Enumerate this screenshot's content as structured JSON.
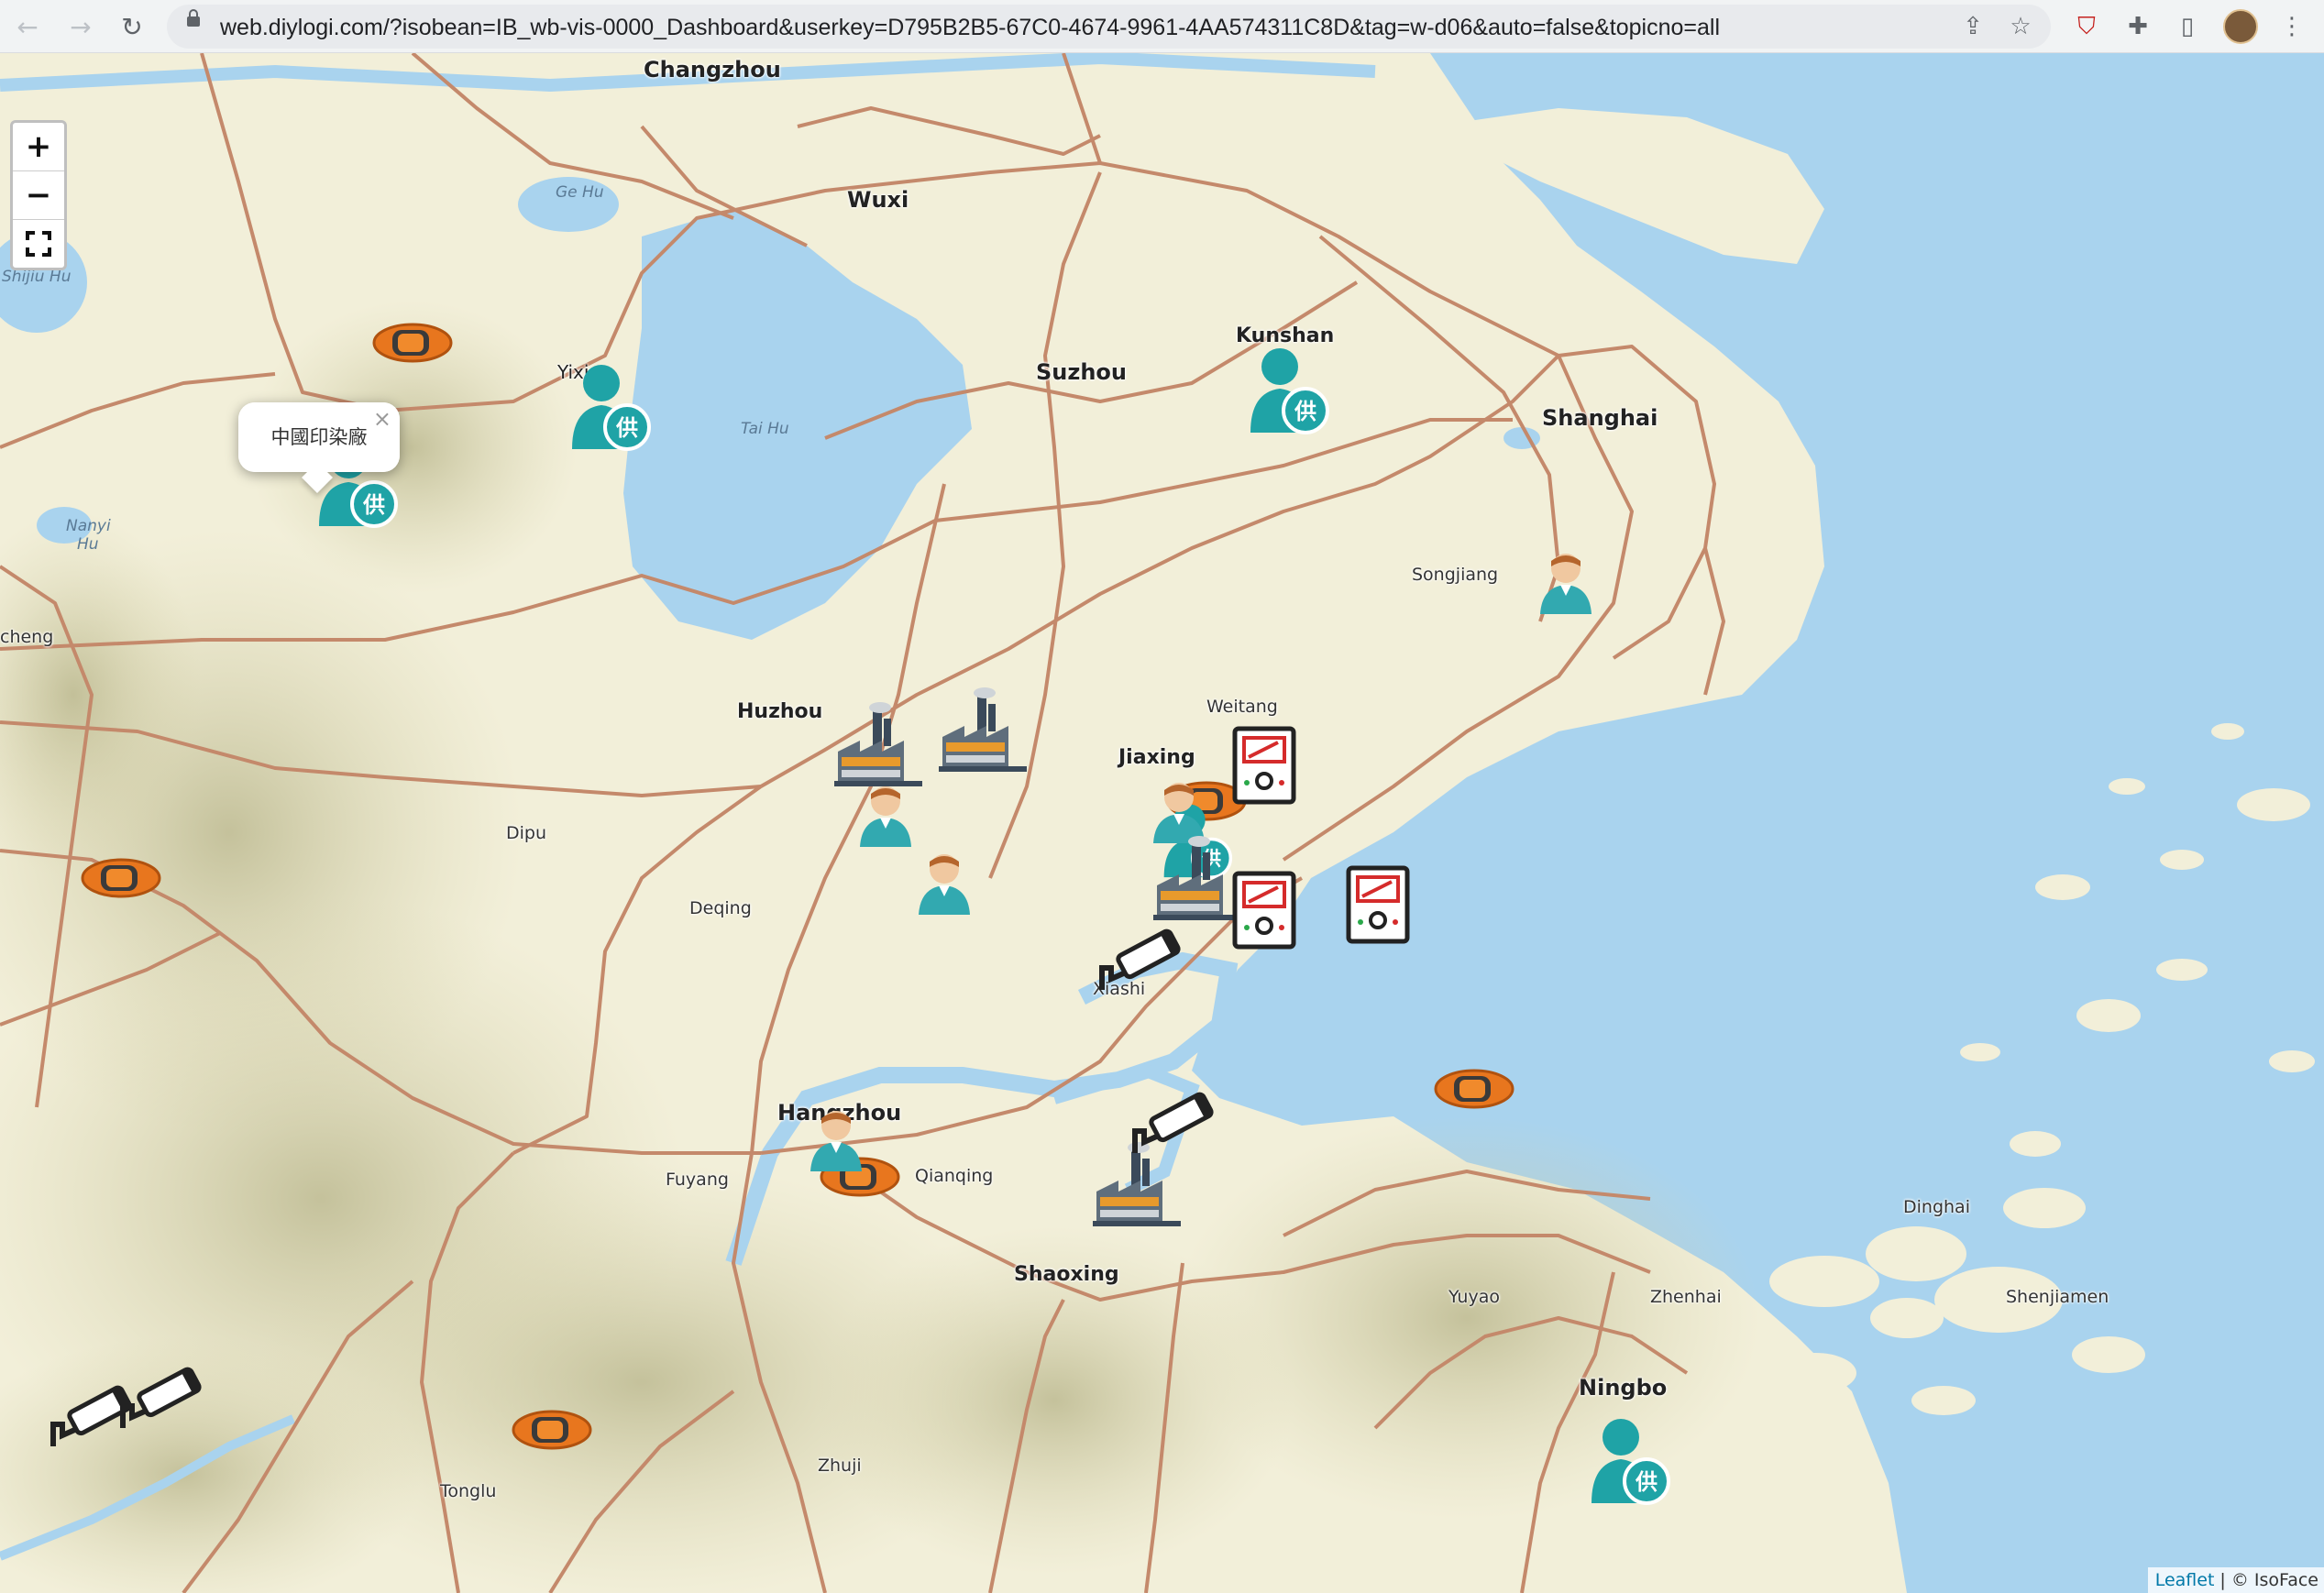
{
  "browser": {
    "url": "web.diylogi.com/?isobean=IB_wb-vis-0000_Dashboard&userkey=D795B2B5-67C0-4674-9961-4AA574311C8D&tag=w-d06&auto=false&topicno=all",
    "back_icon": "back-arrow-icon",
    "forward_icon": "forward-arrow-icon",
    "reload_icon": "reload-icon"
  },
  "map": {
    "zoom_in": "+",
    "zoom_out": "−",
    "fullscreen_icon": "fullscreen-icon",
    "popup_text": "中國印染廠",
    "popup_close": "×",
    "attribution_link": "Leaflet",
    "attribution_text": "| © IsoFace",
    "labels": [
      {
        "id": "changzhou",
        "text": "Changzhou",
        "kind": "city"
      },
      {
        "id": "wuxi",
        "text": "Wuxi",
        "kind": "city"
      },
      {
        "id": "suzhou",
        "text": "Suzhou",
        "kind": "city"
      },
      {
        "id": "kunshan",
        "text": "Kunshan",
        "kind": "city"
      },
      {
        "id": "shanghai",
        "text": "Shanghai",
        "kind": "city"
      },
      {
        "id": "yixing",
        "text": "Yixing",
        "kind": "city"
      },
      {
        "id": "huzhou",
        "text": "Huzhou",
        "kind": "city"
      },
      {
        "id": "jiaxing",
        "text": "Jiaxing",
        "kind": "city"
      },
      {
        "id": "hangzhou",
        "text": "Hangzhou",
        "kind": "city"
      },
      {
        "id": "shaoxing",
        "text": "Shaoxing",
        "kind": "city"
      },
      {
        "id": "ningbo",
        "text": "Ningbo",
        "kind": "city"
      },
      {
        "id": "songjiang",
        "text": "Songjiang",
        "kind": "town"
      },
      {
        "id": "weitang",
        "text": "Weitang",
        "kind": "town"
      },
      {
        "id": "dipu",
        "text": "Dipu",
        "kind": "town"
      },
      {
        "id": "deqing",
        "text": "Deqing",
        "kind": "town"
      },
      {
        "id": "xiashi",
        "text": "Xiashi",
        "kind": "town"
      },
      {
        "id": "fuyang",
        "text": "Fuyang",
        "kind": "town"
      },
      {
        "id": "qianqing",
        "text": "Qianqing",
        "kind": "town"
      },
      {
        "id": "yuyao",
        "text": "Yuyao",
        "kind": "town"
      },
      {
        "id": "zhenhai",
        "text": "Zhenhai",
        "kind": "town"
      },
      {
        "id": "dinghai",
        "text": "Dinghai",
        "kind": "town"
      },
      {
        "id": "shenjiamen",
        "text": "Shenjiamen",
        "kind": "town"
      },
      {
        "id": "zhuji",
        "text": "Zhuji",
        "kind": "town"
      },
      {
        "id": "tonglu",
        "text": "Tonglu",
        "kind": "town"
      },
      {
        "id": "cheng",
        "text": "cheng",
        "kind": "town"
      },
      {
        "id": "gehu",
        "text": "Ge Hu",
        "kind": "water"
      },
      {
        "id": "shijiuhu",
        "text": "Shijiu Hu",
        "kind": "water"
      },
      {
        "id": "taihu",
        "text": "Tai Hu",
        "kind": "water"
      },
      {
        "id": "nanyi",
        "text": "Nanyi",
        "kind": "water"
      },
      {
        "id": "hu",
        "text": "Hu",
        "kind": "water"
      }
    ],
    "marker_types": {
      "car": "orange-car-icon",
      "supplier": "supplier-person-icon",
      "person": "person-icon",
      "factory": "factory-icon",
      "meter": "meter-icon",
      "camera": "cctv-camera-icon"
    }
  }
}
